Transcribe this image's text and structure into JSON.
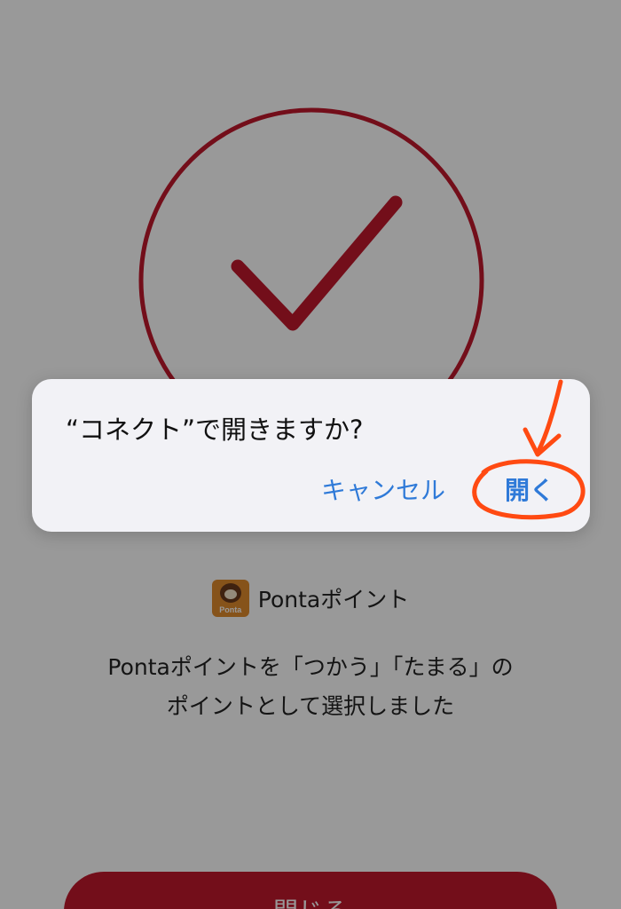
{
  "page": {
    "point_name": "Pontaポイント",
    "logo_word": "Ponta",
    "message_line1": "Pontaポイントを「つかう」「たまる」の",
    "message_line2": "ポイントとして選択しました",
    "close_label": "閉じる"
  },
  "alert": {
    "title": "“コネクト”で開きますか?",
    "cancel_label": "キャンセル",
    "open_label": "開く"
  },
  "colors": {
    "accent_red": "#c0182c",
    "ios_blue": "#2f7ad8",
    "annotation_orange": "#ff4a12",
    "ponta_orange": "#e08a2c"
  },
  "icons": {
    "success": "check-circle-icon",
    "logo": "ponta-logo",
    "annotation": "hand-drawn-arrow-circle"
  }
}
